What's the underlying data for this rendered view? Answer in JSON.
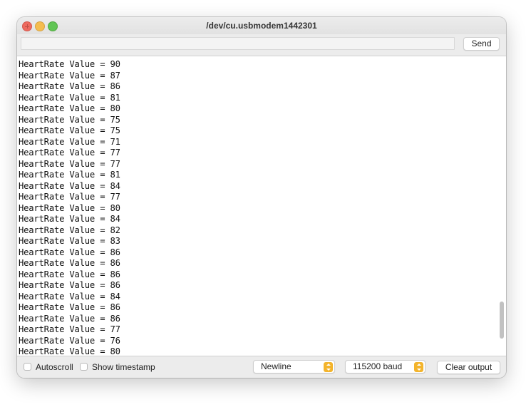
{
  "window": {
    "title": "/dev/cu.usbmodem1442301"
  },
  "send_row": {
    "input_value": "",
    "send_label": "Send"
  },
  "output": {
    "lines": [
      "HeartRate Value = 90",
      "HeartRate Value = 87",
      "HeartRate Value = 86",
      "HeartRate Value = 81",
      "HeartRate Value = 80",
      "HeartRate Value = 75",
      "HeartRate Value = 75",
      "HeartRate Value = 71",
      "HeartRate Value = 77",
      "HeartRate Value = 77",
      "HeartRate Value = 81",
      "HeartRate Value = 84",
      "HeartRate Value = 77",
      "HeartRate Value = 80",
      "HeartRate Value = 84",
      "HeartRate Value = 82",
      "HeartRate Value = 83",
      "HeartRate Value = 86",
      "HeartRate Value = 86",
      "HeartRate Value = 86",
      "HeartRate Value = 86",
      "HeartRate Value = 84",
      "HeartRate Value = 86",
      "HeartRate Value = 86",
      "HeartRate Value = 77",
      "HeartRate Value = 76",
      "HeartRate Value = 80"
    ]
  },
  "bottom_bar": {
    "autoscroll_label": "Autoscroll",
    "autoscroll_checked": false,
    "timestamp_label": "Show timestamp",
    "timestamp_checked": false,
    "line_ending_value": "Newline",
    "baud_value": "115200 baud",
    "clear_label": "Clear output"
  },
  "colors": {
    "accent": "#f3b42c",
    "close": "#ee6a5f",
    "minimize": "#f5bd4f",
    "maximize": "#61c554"
  }
}
